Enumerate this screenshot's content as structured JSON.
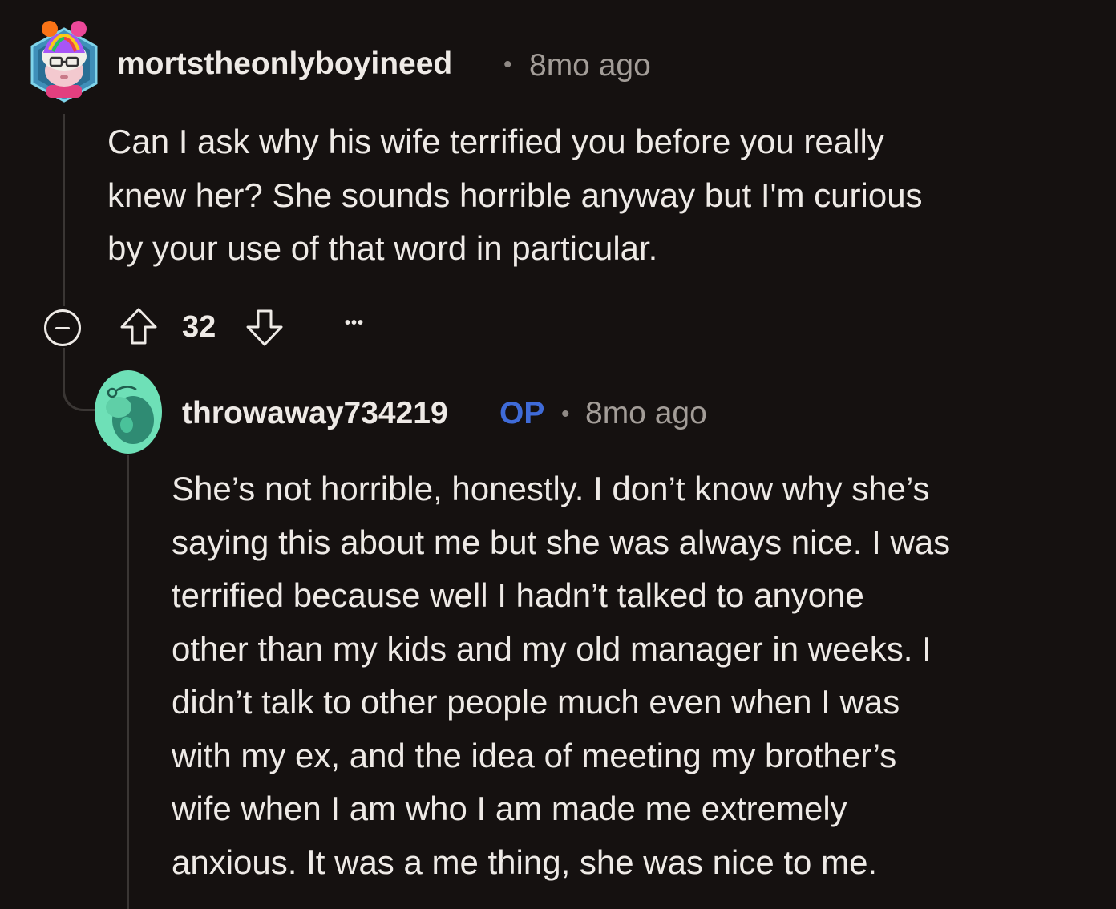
{
  "comment": {
    "username": "mortstheonlyboyineed",
    "separator": "•",
    "timestamp": "8mo ago",
    "body_lines": [
      "Can I ask why his wife terrified you before you really",
      "knew her? She sounds horrible anyway but I'm curious",
      "by your use of that word in particular."
    ],
    "score": "32",
    "more_label": "•••"
  },
  "reply": {
    "username": "throwaway734219",
    "op_badge": "OP",
    "separator": "•",
    "timestamp": "8mo ago",
    "body_lines": [
      "She’s not horrible, honestly. I don’t know why she’s",
      "saying this about me but she was always nice. I was",
      "terrified because well I hadn’t talked to anyone",
      "other than my kids and my old manager in weeks. I",
      "didn’t talk to other people much even when I was",
      "with my ex, and the idea of meeting my brother’s",
      "wife when I am who I am made me extremely",
      "anxious. It was a me thing, she was nice to me."
    ]
  },
  "colors": {
    "background": "#151110",
    "text": "#eeeae6",
    "muted": "#a39d98",
    "op_badge": "#3f6bd8",
    "thread_line": "#3a3634",
    "reply_avatar_bg": "#6ee0b7"
  },
  "icons": {
    "collapse": "minus-circle-icon",
    "upvote": "arrow-up-icon",
    "downvote": "arrow-down-icon",
    "more": "ellipsis-icon"
  }
}
